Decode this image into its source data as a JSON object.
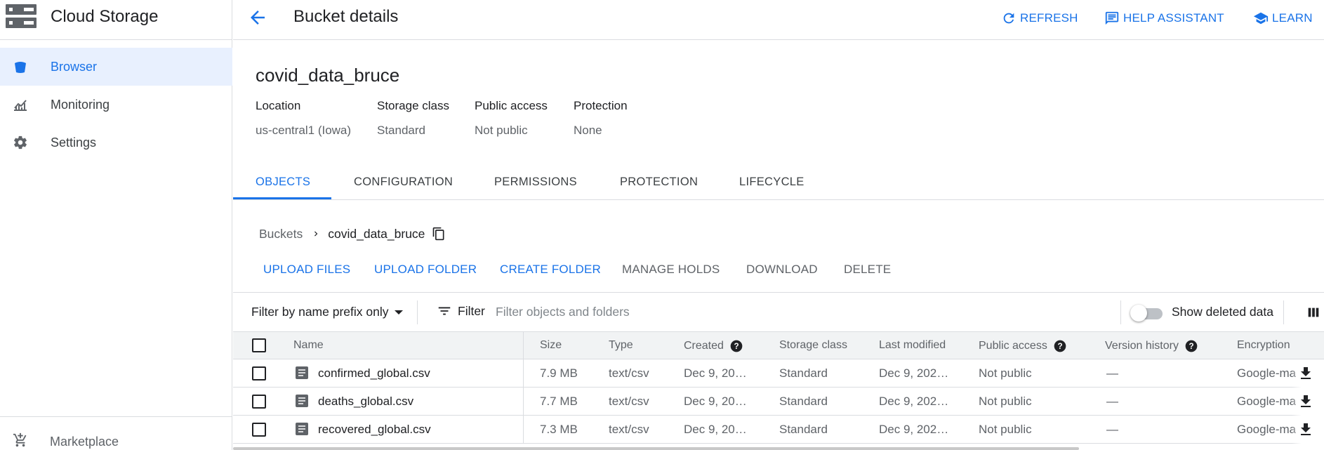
{
  "app": {
    "product_title": "Cloud Storage",
    "page_title": "Bucket details",
    "accent_color": "#1a73e8"
  },
  "sidebar": {
    "items": [
      {
        "label": "Browser",
        "icon": "bucket-icon",
        "active": true
      },
      {
        "label": "Monitoring",
        "icon": "chart-icon",
        "active": false
      },
      {
        "label": "Settings",
        "icon": "gear-icon",
        "active": false
      }
    ],
    "footer": {
      "label": "Marketplace",
      "icon": "cart-icon"
    }
  },
  "topbar": {
    "refresh": "REFRESH",
    "help_assistant": "HELP ASSISTANT",
    "learn": "LEARN"
  },
  "bucket": {
    "name": "covid_data_bruce",
    "meta": [
      {
        "label": "Location",
        "value": "us-central1 (Iowa)"
      },
      {
        "label": "Storage class",
        "value": "Standard"
      },
      {
        "label": "Public access",
        "value": "Not public"
      },
      {
        "label": "Protection",
        "value": "None"
      }
    ]
  },
  "tabs": [
    "OBJECTS",
    "CONFIGURATION",
    "PERMISSIONS",
    "PROTECTION",
    "LIFECYCLE"
  ],
  "breadcrumb": {
    "root": "Buckets",
    "current": "covid_data_bruce"
  },
  "actions": {
    "upload_files": "UPLOAD FILES",
    "upload_folder": "UPLOAD FOLDER",
    "create_folder": "CREATE FOLDER",
    "manage_holds": "MANAGE HOLDS",
    "download": "DOWNLOAD",
    "delete": "DELETE"
  },
  "filter": {
    "mode": "Filter by name prefix only",
    "button": "Filter",
    "placeholder": "Filter objects and folders",
    "show_deleted_label": "Show deleted data",
    "show_deleted": false
  },
  "table": {
    "columns": [
      "Name",
      "Size",
      "Type",
      "Created",
      "Storage class",
      "Last modified",
      "Public access",
      "Version history",
      "Encryption"
    ],
    "rows": [
      {
        "name": "confirmed_global.csv",
        "size": "7.9 MB",
        "type": "text/csv",
        "created": "Dec 9, 20…",
        "storage_class": "Standard",
        "last_modified": "Dec 9, 202…",
        "public_access": "Not public",
        "version_history": "—",
        "encryption": "Google-ma"
      },
      {
        "name": "deaths_global.csv",
        "size": "7.7 MB",
        "type": "text/csv",
        "created": "Dec 9, 20…",
        "storage_class": "Standard",
        "last_modified": "Dec 9, 202…",
        "public_access": "Not public",
        "version_history": "—",
        "encryption": "Google-ma"
      },
      {
        "name": "recovered_global.csv",
        "size": "7.3 MB",
        "type": "text/csv",
        "created": "Dec 9, 20…",
        "storage_class": "Standard",
        "last_modified": "Dec 9, 202…",
        "public_access": "Not public",
        "version_history": "—",
        "encryption": "Google-ma"
      }
    ]
  }
}
